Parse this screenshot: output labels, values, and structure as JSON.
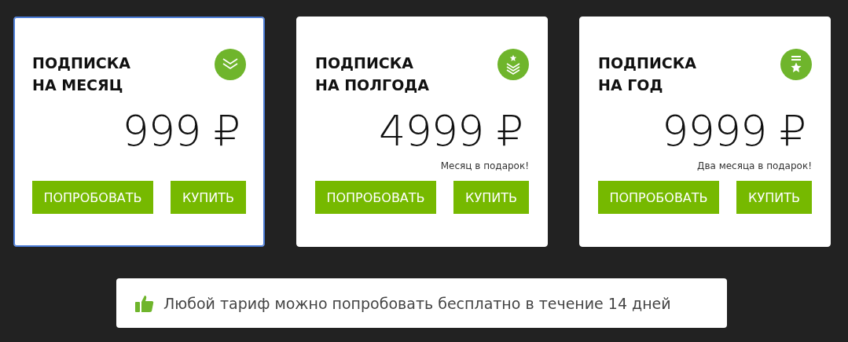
{
  "plans": [
    {
      "title_lines": [
        "ПОДПИСКА",
        "НА МЕСЯЦ"
      ],
      "price": "999 ₽",
      "selected": true,
      "buttons": [
        "ПОПРОБОВАТЬ",
        "КУПИТЬ"
      ]
    },
    {
      "title_lines": [
        "ПОДПИСКА",
        "НА ПОЛГОДА"
      ],
      "price": "4999 ₽",
      "note": "Месяц в подарок!",
      "selected": false,
      "buttons": [
        "ПОПРОБОВАТЬ",
        "КУПИТЬ"
      ]
    },
    {
      "title_lines": [
        "ПОДПИСКА",
        "НА ГОД"
      ],
      "price": "9999 ₽",
      "note": "Два месяца в подарок!",
      "selected": false,
      "buttons": [
        "ПОПРОБОВАТЬ",
        "КУПИТЬ"
      ]
    }
  ],
  "footer": {
    "text": "Любой тариф можно попробовать бесплатно в течение 14 дней"
  }
}
